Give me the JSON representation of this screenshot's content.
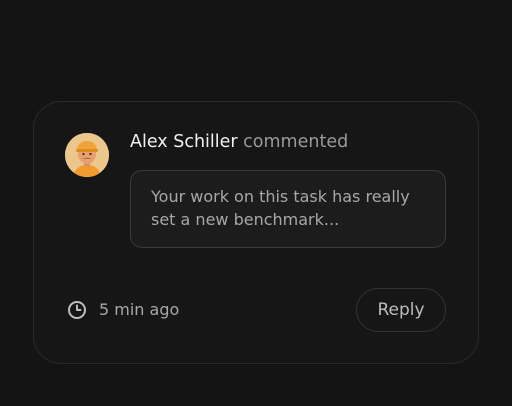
{
  "comment": {
    "author": "Alex Schiller",
    "action": "commented",
    "message": "Your work on this task has really set a new benchmark...",
    "time": "5 min ago",
    "avatar_icon": "user-avatar"
  },
  "actions": {
    "reply_label": "Reply"
  },
  "icons": {
    "time": "clock-icon"
  },
  "colors": {
    "background": "#141414",
    "card_border": "#2a2a2a",
    "text_primary": "#f2f2f2",
    "text_secondary": "#9a9a9a"
  }
}
